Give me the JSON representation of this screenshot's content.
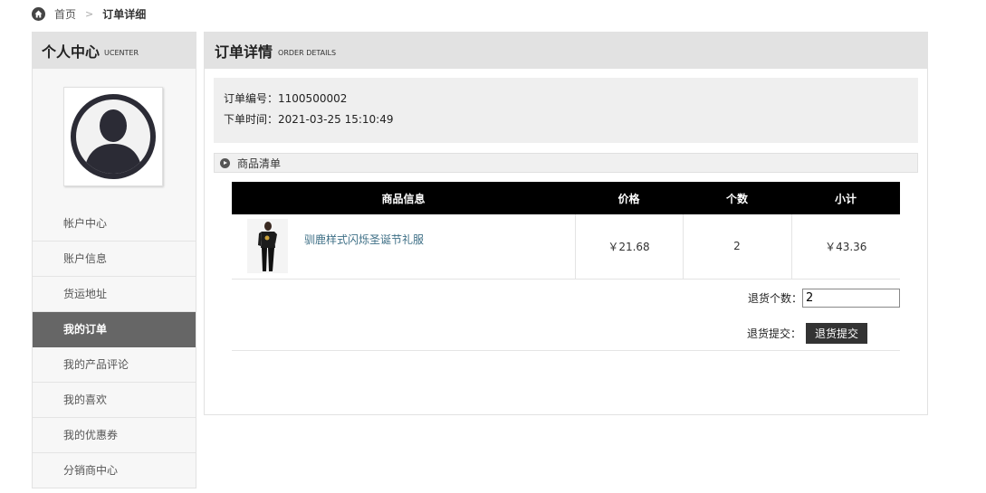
{
  "breadcrumb": {
    "home": "首页",
    "separator": ">",
    "current": "订单详细"
  },
  "sidebar": {
    "title": "个人中心",
    "subtitle": "UCENTER",
    "items": [
      {
        "label": "帐户中心"
      },
      {
        "label": "账户信息"
      },
      {
        "label": "货运地址"
      },
      {
        "label": "我的订单",
        "active": true
      },
      {
        "label": "我的产品评论"
      },
      {
        "label": "我的喜欢"
      },
      {
        "label": "我的优惠券"
      },
      {
        "label": "分销商中心"
      }
    ]
  },
  "main": {
    "title": "订单详情",
    "subtitle": "ORDER DETAILS",
    "order_no_label": "订单编号：",
    "order_no": "1100500002",
    "order_time_label": "下单时间：",
    "order_time": "2021-03-25 15:10:49",
    "section_title": "商品清单",
    "table": {
      "headers": [
        "商品信息",
        "价格",
        "个数",
        "小计"
      ],
      "rows": [
        {
          "name": "驯鹿样式闪烁圣诞节礼服",
          "price": "￥21.68",
          "qty": "2",
          "subtotal": "￥43.36"
        }
      ]
    },
    "return_qty_label": "退货个数：",
    "return_qty_value": "2",
    "return_submit_label": "退货提交：",
    "return_submit_button": "退货提交"
  },
  "colors": {
    "active_menu_bg": "#666666",
    "header_bg": "#e2e2e2",
    "table_head_bg": "#000000",
    "link": "#3e6f86"
  }
}
